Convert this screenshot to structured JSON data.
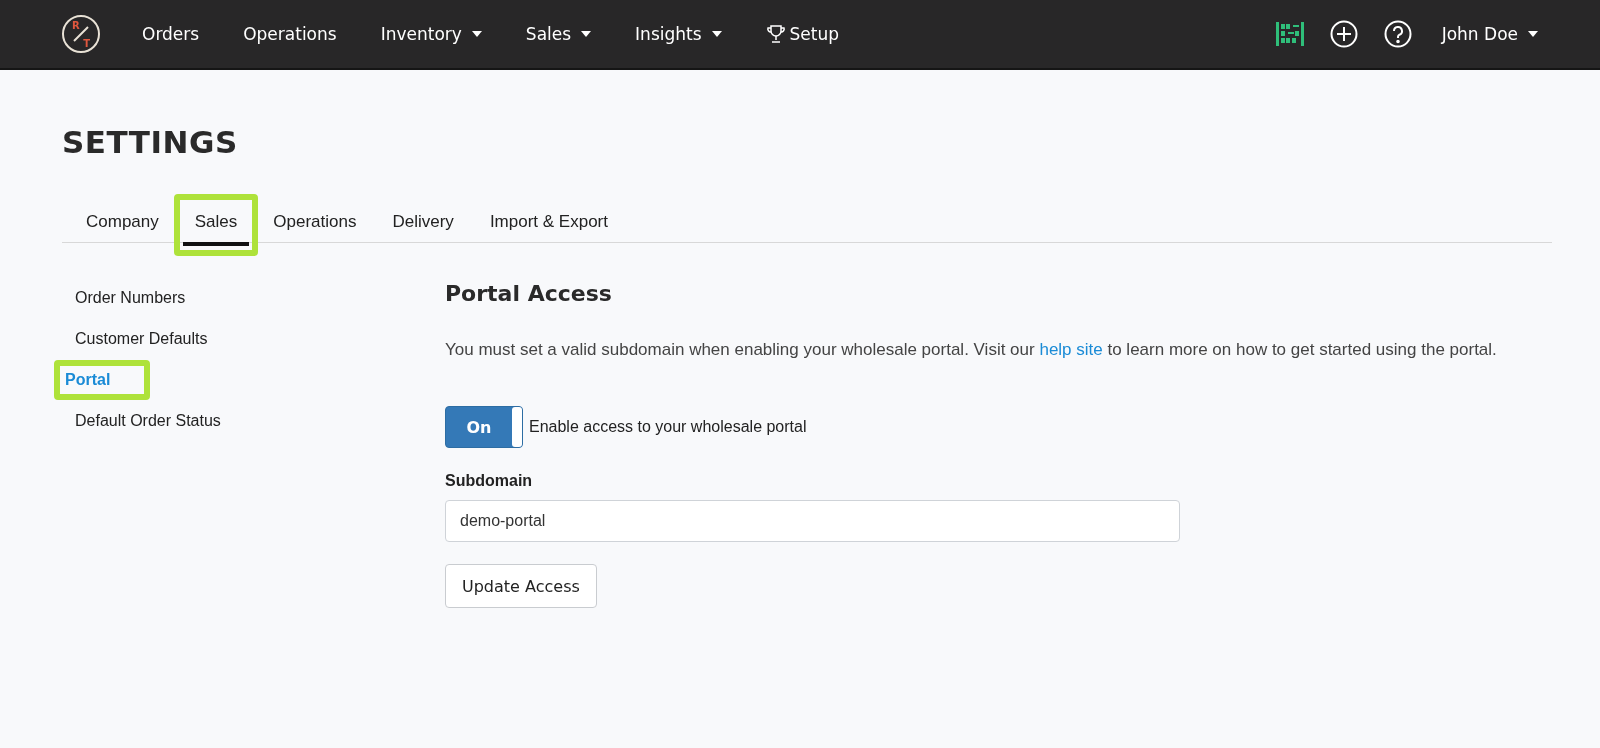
{
  "nav": {
    "logo_letters": [
      "R",
      "T"
    ],
    "items": [
      {
        "label": "Orders",
        "kind": "link"
      },
      {
        "label": "Operations",
        "kind": "link"
      },
      {
        "label": "Inventory",
        "kind": "menu"
      },
      {
        "label": "Sales",
        "kind": "menu"
      },
      {
        "label": "Insights",
        "kind": "menu"
      },
      {
        "label": "Setup",
        "kind": "trophy"
      }
    ],
    "user": "John Doe"
  },
  "page_title": "SETTINGS",
  "tabs": [
    {
      "label": "Company",
      "selected": false,
      "highlighted": false
    },
    {
      "label": "Sales",
      "selected": true,
      "highlighted": true
    },
    {
      "label": "Operations",
      "selected": false,
      "highlighted": false
    },
    {
      "label": "Delivery",
      "selected": false,
      "highlighted": false
    },
    {
      "label": "Import & Export",
      "selected": false,
      "highlighted": false
    }
  ],
  "sidebar": {
    "items": [
      {
        "label": "Order Numbers",
        "selected": false,
        "highlighted": false
      },
      {
        "label": "Customer Defaults",
        "selected": false,
        "highlighted": false
      },
      {
        "label": "Portal",
        "selected": true,
        "highlighted": true
      },
      {
        "label": "Default Order Status",
        "selected": false,
        "highlighted": false
      }
    ]
  },
  "section": {
    "title": "Portal Access",
    "description_before": "You must set a valid subdomain when enabling your wholesale portal. Visit our ",
    "description_link": "help site",
    "description_after": " to learn more on how to get started using the portal.",
    "toggle": {
      "text": "On",
      "on": true,
      "label": "Enable access to your wholesale portal"
    },
    "field": {
      "label": "Subdomain",
      "value": "demo-portal"
    },
    "button": "Update Access"
  }
}
